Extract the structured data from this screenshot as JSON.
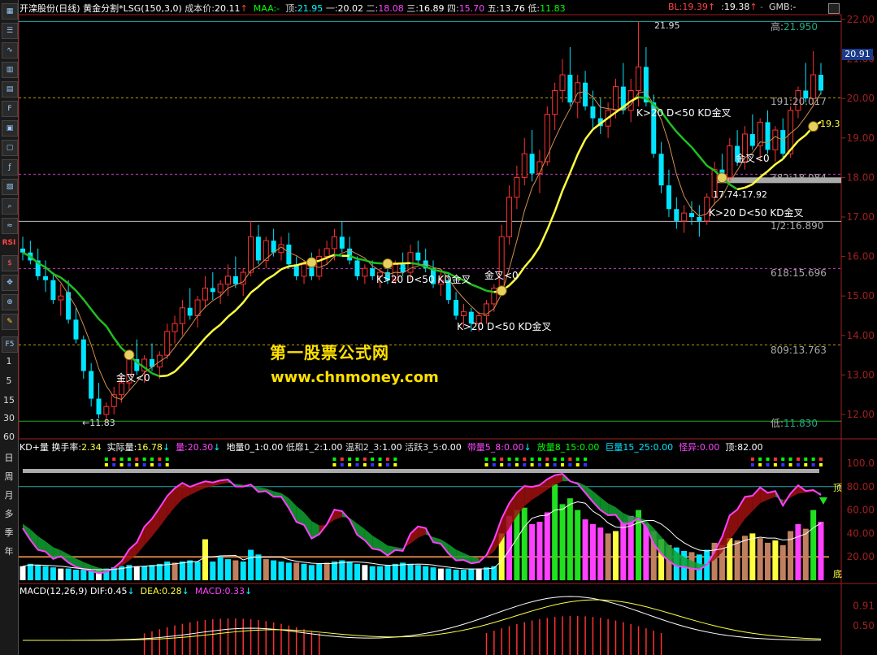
{
  "header": {
    "stock_name": "开滦股份(日线)",
    "indicator": "黄金分割*LSG(150,3,0)",
    "cost_label": "成本价:",
    "cost_value": "20.11",
    "maa_label": "MAA:",
    "top_label": "顶:",
    "top_value": "21.95",
    "one_label": "一:",
    "one_value": "20.02",
    "two_label": "二:",
    "two_value": "18.08",
    "three_label": "三:",
    "three_value": "16.89",
    "four_label": "四:",
    "four_value": "15.70",
    "five_label": "五:",
    "five_value": "13.76",
    "low_label": "低:",
    "low_value": "11.83",
    "bl_label": "BL:",
    "bl_value": "19.39",
    "colon_label": ":",
    "colon_value": "19.38",
    "gmb_label": "GMB:"
  },
  "toolbar": {
    "buttons": [
      "日",
      "周",
      "月",
      "多",
      "季",
      "年"
    ],
    "periods": [
      "1",
      "5",
      "15",
      "30",
      "60"
    ],
    "rsi_label": "RSI"
  },
  "price_panel": {
    "high_label": "高:",
    "high_value": "21.950",
    "low_label": "低:",
    "low_value": "11.830",
    "fib_191": "191:20.017",
    "fib_382": "382:18.084",
    "fib_half": "1/2:16.890",
    "fib_618": "618:15.696",
    "fib_809": "809:13.763",
    "peak_label": "21.95",
    "trough_label": "←11.83",
    "range_label": "17.74-17.92",
    "current_price_tag": "20.91",
    "ma_end_label": "19.3",
    "annotations": [
      "K>20 D<50 KD金叉",
      "K>20 D<50 KD金叉",
      "K>20 D<50 KD金叉",
      "K>20 D<50 KD金叉",
      "金叉<0",
      "金叉<0",
      "金叉<0"
    ],
    "yaxis": [
      "22.00",
      "21.00",
      "20.00",
      "19.00",
      "18.00",
      "17.00",
      "16.00",
      "15.00",
      "14.00",
      "13.00",
      "12.00"
    ]
  },
  "watermark": {
    "line1": "第一股票公式网",
    "line2": "www.chnmoney.com"
  },
  "kd_panel": {
    "title": "KD+量",
    "turnover_label": "换手率:",
    "turnover_value": "2.34",
    "actual_label": "实际量:",
    "actual_value": "16.78",
    "vol_label": "量:",
    "vol_value": "20.30",
    "ground_label": "地量0_1:",
    "ground_value": "0.00",
    "low_label": "低靡1_2:",
    "low_value": "1.00",
    "mild_label": "温和2_3:",
    "mild_value": "1.00",
    "active_label": "活跃3_5:",
    "active_value": "0.00",
    "band_label": "带量5_8:",
    "band_value": "0.00",
    "big_label": "放量8_15:",
    "big_value": "0.00",
    "huge_label": "巨量15_25:",
    "huge_value": "0.00",
    "odd_label": "怪异:",
    "odd_value": "0.00",
    "top_label": "顶:",
    "top_value": "82.00",
    "yaxis": [
      "100.0",
      "80.00",
      "60.00",
      "40.00",
      "20.00"
    ],
    "side_top": "顶",
    "side_bottom": "底"
  },
  "macd_panel": {
    "title": "MACD(12,26,9)",
    "dif_label": "DIF:",
    "dif_value": "0.45",
    "dea_label": "DEA:",
    "dea_value": "0.28",
    "macd_label": "MACD:",
    "macd_value": "0.33",
    "yaxis": [
      "0.91",
      "0.50"
    ]
  },
  "colors": {
    "up": "#ff3030",
    "down": "#00e5ff",
    "yellow_ma": "#ffff40",
    "green_ma": "#20c020",
    "thin_ma": "#d09050",
    "magenta": "#ff40ff",
    "fib_line": "#c0a000",
    "purple_line": "#c040c0"
  },
  "chart_data": [
    {
      "type": "candlestick",
      "title": "开滦股份(日线)",
      "ylim": [
        11.5,
        22.3
      ],
      "candles": [
        [
          16.2,
          16.5,
          15.9,
          16.1
        ],
        [
          16.1,
          16.4,
          15.8,
          15.9
        ],
        [
          15.9,
          16.2,
          15.4,
          15.5
        ],
        [
          15.5,
          15.9,
          15.1,
          15.4
        ],
        [
          15.4,
          15.6,
          14.8,
          14.9
        ],
        [
          14.9,
          15.3,
          14.5,
          15.0
        ],
        [
          15.1,
          15.4,
          14.3,
          14.4
        ],
        [
          14.4,
          14.7,
          13.8,
          13.9
        ],
        [
          13.9,
          14.0,
          12.9,
          13.1
        ],
        [
          13.1,
          13.3,
          12.2,
          12.4
        ],
        [
          12.4,
          12.8,
          11.9,
          12.0
        ],
        [
          12.0,
          12.3,
          11.83,
          12.2
        ],
        [
          12.2,
          12.7,
          12.0,
          12.5
        ],
        [
          12.5,
          13.0,
          12.3,
          12.8
        ],
        [
          12.8,
          13.6,
          12.6,
          13.5
        ],
        [
          13.4,
          13.9,
          13.0,
          13.1
        ],
        [
          13.1,
          13.5,
          12.8,
          13.4
        ],
        [
          13.4,
          13.8,
          13.1,
          13.2
        ],
        [
          13.2,
          13.6,
          12.9,
          13.5
        ],
        [
          13.5,
          14.3,
          13.4,
          14.1
        ],
        [
          14.1,
          14.5,
          13.8,
          14.3
        ],
        [
          14.3,
          14.9,
          14.0,
          14.7
        ],
        [
          14.7,
          15.2,
          14.4,
          14.5
        ],
        [
          14.5,
          15.0,
          14.2,
          14.9
        ],
        [
          14.9,
          15.5,
          14.7,
          15.2
        ],
        [
          15.2,
          15.6,
          14.9,
          15.1
        ],
        [
          15.1,
          15.4,
          14.8,
          15.3
        ],
        [
          15.3,
          15.8,
          15.0,
          15.5
        ],
        [
          15.5,
          16.0,
          15.2,
          15.3
        ],
        [
          15.3,
          15.7,
          15.0,
          15.6
        ],
        [
          15.6,
          16.9,
          15.5,
          16.5
        ],
        [
          16.5,
          16.8,
          15.8,
          15.9
        ],
        [
          15.9,
          16.5,
          15.7,
          16.4
        ],
        [
          16.4,
          16.7,
          16.0,
          16.1
        ],
        [
          16.1,
          16.5,
          15.9,
          16.3
        ],
        [
          16.3,
          16.6,
          15.7,
          15.8
        ],
        [
          15.8,
          16.0,
          15.4,
          15.5
        ],
        [
          15.5,
          15.9,
          15.3,
          15.8
        ],
        [
          15.8,
          16.1,
          15.4,
          15.5
        ],
        [
          15.5,
          16.2,
          15.4,
          16.0
        ],
        [
          16.0,
          16.4,
          15.8,
          16.2
        ],
        [
          16.2,
          16.7,
          15.9,
          16.5
        ],
        [
          16.5,
          16.9,
          16.1,
          16.2
        ],
        [
          16.2,
          16.5,
          15.8,
          15.9
        ],
        [
          15.9,
          16.0,
          15.4,
          15.5
        ],
        [
          15.5,
          15.8,
          15.3,
          15.7
        ],
        [
          15.7,
          15.9,
          15.4,
          15.5
        ],
        [
          15.5,
          15.7,
          15.2,
          15.6
        ],
        [
          15.6,
          15.8,
          15.3,
          15.4
        ],
        [
          15.4,
          15.9,
          15.3,
          15.8
        ],
        [
          15.8,
          16.1,
          15.5,
          15.6
        ],
        [
          15.6,
          16.3,
          15.4,
          16.1
        ],
        [
          16.1,
          16.4,
          15.8,
          15.9
        ],
        [
          15.9,
          16.2,
          15.6,
          15.7
        ],
        [
          15.7,
          15.9,
          15.2,
          15.3
        ],
        [
          15.3,
          15.6,
          15.0,
          15.4
        ],
        [
          15.4,
          15.6,
          14.8,
          14.9
        ],
        [
          14.9,
          15.1,
          14.4,
          14.5
        ],
        [
          14.5,
          14.8,
          14.2,
          14.6
        ],
        [
          14.6,
          14.7,
          14.1,
          14.3
        ],
        [
          14.3,
          14.6,
          14.1,
          14.5
        ],
        [
          14.5,
          14.9,
          14.3,
          14.8
        ],
        [
          14.8,
          15.3,
          14.6,
          15.2
        ],
        [
          15.2,
          16.8,
          15.0,
          16.5
        ],
        [
          16.5,
          17.8,
          16.3,
          17.5
        ],
        [
          17.5,
          18.3,
          17.2,
          18.0
        ],
        [
          18.0,
          19.0,
          17.8,
          18.6
        ],
        [
          18.6,
          19.2,
          17.9,
          18.1
        ],
        [
          18.1,
          18.7,
          17.6,
          18.4
        ],
        [
          18.4,
          19.8,
          18.3,
          19.6
        ],
        [
          19.6,
          20.4,
          19.2,
          20.2
        ],
        [
          20.2,
          21.0,
          19.9,
          20.6
        ],
        [
          20.6,
          21.3,
          19.8,
          19.9
        ],
        [
          19.9,
          20.6,
          19.5,
          20.4
        ],
        [
          20.4,
          20.7,
          19.7,
          19.8
        ],
        [
          19.8,
          20.2,
          19.2,
          19.5
        ],
        [
          19.5,
          20.0,
          19.1,
          19.3
        ],
        [
          19.3,
          19.9,
          19.0,
          19.7
        ],
        [
          19.7,
          20.5,
          19.5,
          20.3
        ],
        [
          20.3,
          20.9,
          19.6,
          19.7
        ],
        [
          19.7,
          20.5,
          19.4,
          20.2
        ],
        [
          20.2,
          21.95,
          19.8,
          20.8
        ],
        [
          20.8,
          21.3,
          19.8,
          19.9
        ],
        [
          19.9,
          20.1,
          18.5,
          18.6
        ],
        [
          18.6,
          18.9,
          17.6,
          17.8
        ],
        [
          17.8,
          18.2,
          17.0,
          17.2
        ],
        [
          17.2,
          17.5,
          16.7,
          16.9
        ],
        [
          16.9,
          17.3,
          16.6,
          17.1
        ],
        [
          17.1,
          17.4,
          16.8,
          17.0
        ],
        [
          17.0,
          17.3,
          16.5,
          16.9
        ],
        [
          16.9,
          17.6,
          16.8,
          17.5
        ],
        [
          17.5,
          18.4,
          17.3,
          18.2
        ],
        [
          18.2,
          18.6,
          17.9,
          18.0
        ],
        [
          18.0,
          19.0,
          17.9,
          18.8
        ],
        [
          18.8,
          19.2,
          18.3,
          18.4
        ],
        [
          18.4,
          19.3,
          18.2,
          19.1
        ],
        [
          19.1,
          19.6,
          18.7,
          18.8
        ],
        [
          18.8,
          19.5,
          18.4,
          19.4
        ],
        [
          19.4,
          19.7,
          18.6,
          18.7
        ],
        [
          18.7,
          19.3,
          18.4,
          19.2
        ],
        [
          19.2,
          19.5,
          18.5,
          18.6
        ],
        [
          18.6,
          19.8,
          18.5,
          19.7
        ],
        [
          19.7,
          20.3,
          19.5,
          20.2
        ],
        [
          20.2,
          20.9,
          19.9,
          20.0
        ],
        [
          20.0,
          21.2,
          19.8,
          20.6
        ],
        [
          20.6,
          20.9,
          20.1,
          20.2
        ]
      ]
    },
    {
      "type": "bar",
      "title": "KD+量",
      "ylim": [
        0,
        100
      ],
      "values": [
        12,
        14,
        13,
        12,
        11,
        10,
        10,
        9,
        9,
        8,
        9,
        10,
        11,
        12,
        13,
        12,
        12,
        13,
        14,
        16,
        15,
        16,
        17,
        16,
        35,
        16,
        20,
        18,
        17,
        16,
        26,
        22,
        18,
        17,
        16,
        15,
        15,
        14,
        13,
        14,
        15,
        16,
        17,
        16,
        14,
        13,
        12,
        12,
        13,
        14,
        15,
        14,
        13,
        12,
        11,
        10,
        10,
        9,
        9,
        10,
        10,
        11,
        12,
        40,
        55,
        60,
        62,
        48,
        50,
        58,
        82,
        65,
        70,
        60,
        52,
        48,
        45,
        40,
        42,
        50,
        55,
        60,
        48,
        42,
        35,
        30,
        28,
        25,
        24,
        22,
        26,
        32,
        30,
        36,
        34,
        38,
        40,
        36,
        32,
        34,
        30,
        42,
        48,
        44,
        60,
        50
      ]
    },
    {
      "type": "line",
      "title": "MACD(12,26,9)",
      "series": [
        {
          "name": "DIF",
          "value": 0.45
        },
        {
          "name": "DEA",
          "value": 0.28
        },
        {
          "name": "MACD",
          "value": 0.33
        }
      ]
    }
  ]
}
